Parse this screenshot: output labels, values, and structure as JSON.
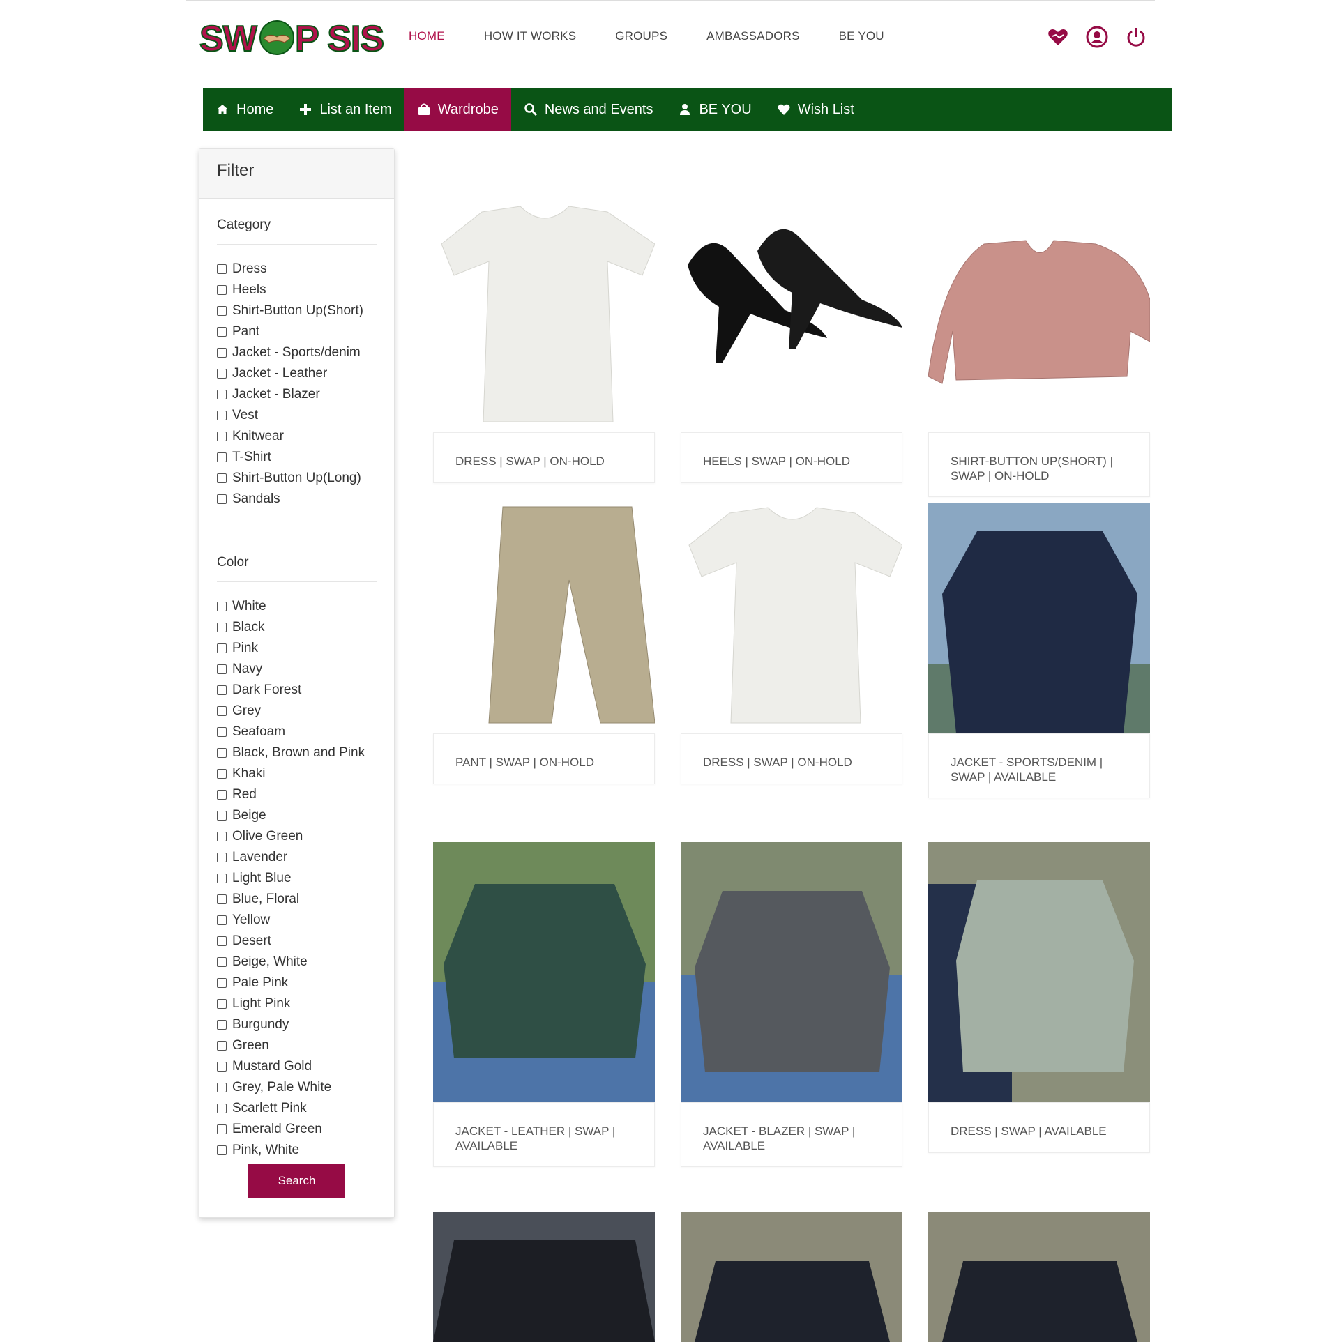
{
  "logo": {
    "text": "SWOP SIS"
  },
  "topnav": [
    {
      "label": "HOME",
      "active": true
    },
    {
      "label": "HOW IT WORKS"
    },
    {
      "label": "GROUPS"
    },
    {
      "label": "AMBASSADORS"
    },
    {
      "label": "BE YOU"
    }
  ],
  "header_icons": [
    "heart-hands-icon",
    "user-circle-icon",
    "power-icon"
  ],
  "mainnav": [
    {
      "label": "Home",
      "icon": "home-icon"
    },
    {
      "label": "List an Item",
      "icon": "plus-icon"
    },
    {
      "label": "Wardrobe",
      "icon": "shopping-bag-icon",
      "active": true
    },
    {
      "label": "News and Events",
      "icon": "search-icon"
    },
    {
      "label": "BE YOU",
      "icon": "user-icon"
    },
    {
      "label": "Wish List",
      "icon": "heart-icon"
    }
  ],
  "filter": {
    "title": "Filter",
    "category_title": "Category",
    "categories": [
      "Dress",
      "Heels",
      "Shirt-Button Up(Short)",
      "Pant",
      "Jacket - Sports/denim",
      "Jacket - Leather",
      "Jacket - Blazer",
      "Vest",
      "Knitwear",
      "T-Shirt",
      "Shirt-Button Up(Long)",
      "Sandals"
    ],
    "color_title": "Color",
    "colors": [
      "White",
      "Black",
      "Pink",
      "Navy",
      "Dark Forest",
      "Grey",
      "Seafoam",
      "Black, Brown and Pink",
      "Khaki",
      "Red",
      "Beige",
      "Olive Green",
      "Lavender",
      "Light Blue",
      "Blue, Floral",
      "Yellow",
      "Desert",
      "Beige, White",
      "Pale Pink",
      "Light Pink",
      "Burgundy",
      "Green",
      "Mustard Gold",
      "Grey, Pale White",
      "Scarlett Pink",
      "Emerald Green",
      "Pink, White"
    ],
    "search_label": "Search"
  },
  "products": [
    {
      "caption": "DRESS | SWAP | ON-HOLD",
      "image": "white-lace-top"
    },
    {
      "caption": "HEELS | SWAP | ON-HOLD",
      "image": "black-patent-heels"
    },
    {
      "caption": "SHIRT-BUTTON UP(SHORT) | SWAP | ON-HOLD",
      "image": "pink-blouse"
    },
    {
      "caption": "PANT | SWAP | ON-HOLD",
      "image": "khaki-pleated-pants"
    },
    {
      "caption": "DRESS | SWAP | ON-HOLD",
      "image": "white-lace-top"
    },
    {
      "caption": "JACKET - SPORTS/DENIM | SWAP | AVAILABLE",
      "image": "navy-top-on-hanger"
    },
    {
      "caption": "JACKET - LEATHER | SWAP | AVAILABLE",
      "image": "green-leather-jacket"
    },
    {
      "caption": "JACKET - BLAZER | SWAP | AVAILABLE",
      "image": "grey-blazer"
    },
    {
      "caption": "DRESS | SWAP | AVAILABLE",
      "image": "seafoam-dress"
    },
    {
      "caption": "",
      "image": "black-leather-jacket"
    },
    {
      "caption": "",
      "image": "black-blazer"
    },
    {
      "caption": "",
      "image": "black-blazer"
    }
  ],
  "colors": {
    "brand": "#960b45",
    "nav_green": "#0a5415",
    "active_link": "#b0124b"
  }
}
